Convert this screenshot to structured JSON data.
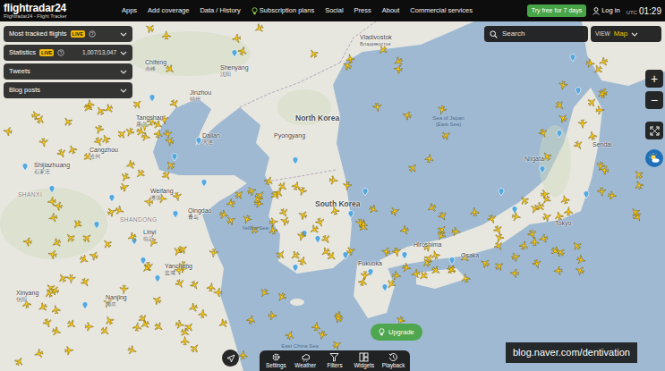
{
  "header": {
    "logo": "flightradar24",
    "subtitle": "Flightradar24 - Flight Tracker",
    "nav": [
      {
        "label": "Apps",
        "kind": "link"
      },
      {
        "label": "Add coverage",
        "kind": "link"
      },
      {
        "label": "Data / History",
        "kind": "link"
      },
      {
        "label": "Subscription plans",
        "kind": "featured"
      },
      {
        "label": "Social",
        "kind": "link"
      },
      {
        "label": "Press",
        "kind": "link"
      },
      {
        "label": "About",
        "kind": "link"
      },
      {
        "label": "Commercial services",
        "kind": "link"
      }
    ],
    "trial_button": "Try free for 7 days",
    "login": "Log in",
    "clock": {
      "zone": "UTC",
      "time": "01:29"
    }
  },
  "panels": [
    {
      "title": "Most tracked flights",
      "badge": "LIVE",
      "expanded": false
    },
    {
      "title": "Statistics",
      "badge": "LIVE",
      "value": "1,007/13,047",
      "expanded": false
    },
    {
      "title": "Tweets",
      "expanded": false
    },
    {
      "title": "Blog posts",
      "expanded": false
    }
  ],
  "search": {
    "placeholder": "Search"
  },
  "view": {
    "label": "VIEW",
    "value": "Map"
  },
  "zoom": {
    "in": "+",
    "out": "−"
  },
  "map": {
    "labels": [
      {
        "text": "Vladivostok",
        "local": "Владивосток",
        "kind": "city"
      },
      {
        "text": "Shenyang",
        "local": "沈阳",
        "kind": "city"
      },
      {
        "text": "Chifeng",
        "local": "赤峰",
        "kind": "city"
      },
      {
        "text": "Jinzhou",
        "local": "锦州",
        "kind": "city"
      },
      {
        "text": "Tangshan",
        "local": "唐山",
        "kind": "city"
      },
      {
        "text": "Dalian",
        "local": "大连",
        "kind": "city"
      },
      {
        "text": "Cangzhou",
        "local": "沧州",
        "kind": "city"
      },
      {
        "text": "Shijiazhuang",
        "local": "石家庄",
        "kind": "city"
      },
      {
        "text": "SHANXI",
        "kind": "region"
      },
      {
        "text": "Weifang",
        "local": "潍坊",
        "kind": "city"
      },
      {
        "text": "Qingdao",
        "local": "青岛",
        "kind": "city"
      },
      {
        "text": "SHANDONG",
        "kind": "region"
      },
      {
        "text": "Linyi",
        "local": "临沂",
        "kind": "city"
      },
      {
        "text": "Yancheng",
        "local": "盐城",
        "kind": "city"
      },
      {
        "text": "Xinyang",
        "local": "信阳",
        "kind": "city"
      },
      {
        "text": "Nanjing",
        "local": "南京",
        "kind": "city"
      },
      {
        "text": "North Korea",
        "kind": "country"
      },
      {
        "text": "Pyongyang",
        "kind": "city"
      },
      {
        "text": "South Korea",
        "kind": "country"
      },
      {
        "text": "Sea of Japan (East Sea)",
        "kind": "sea"
      },
      {
        "text": "Yellow Sea",
        "kind": "sea"
      },
      {
        "text": "East China Sea",
        "kind": "sea"
      },
      {
        "text": "Sendai",
        "kind": "city"
      },
      {
        "text": "Niigata",
        "kind": "city"
      },
      {
        "text": "Tokyo",
        "kind": "city"
      },
      {
        "text": "Osaka",
        "kind": "city"
      },
      {
        "text": "Hiroshima",
        "kind": "city"
      },
      {
        "text": "Fukuoka",
        "kind": "city"
      }
    ]
  },
  "toolbar": [
    {
      "label": "Settings"
    },
    {
      "label": "Weather"
    },
    {
      "label": "Filters"
    },
    {
      "label": "Widgets"
    },
    {
      "label": "Playback"
    }
  ],
  "upgrade": "Upgrade",
  "watermark": "blog.naver.com/dentivation"
}
